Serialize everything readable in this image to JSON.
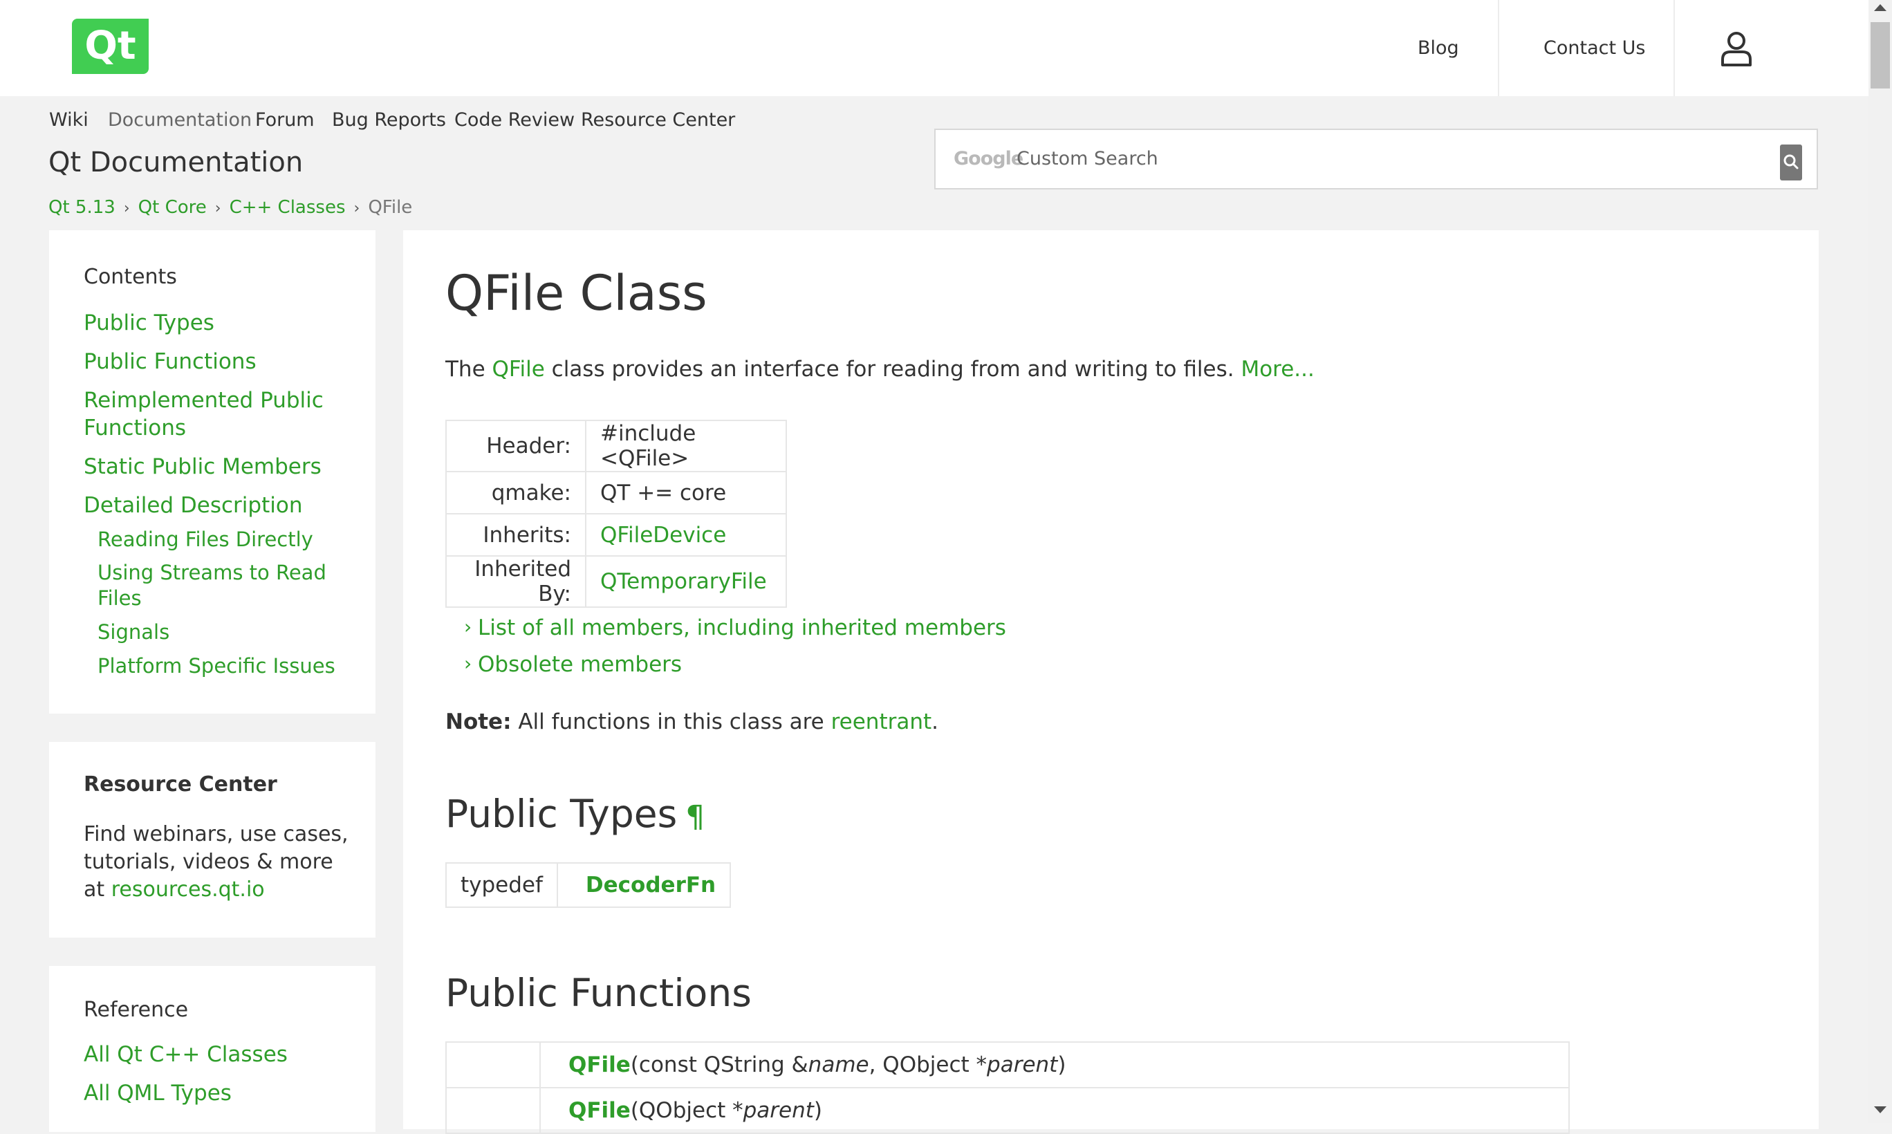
{
  "header": {
    "logo_text": "Qt",
    "nav": {
      "blog": "Blog",
      "contact": "Contact Us"
    }
  },
  "subnav": {
    "items": [
      "Wiki",
      "Documentation",
      "Forum",
      "Bug Reports",
      "Code Review",
      "Resource Center"
    ]
  },
  "site_title": "Qt Documentation",
  "breadcrumb": [
    "Qt 5.13",
    "Qt Core",
    "C++ Classes",
    "QFile"
  ],
  "search": {
    "brand": "Google",
    "placeholder": "Custom Search"
  },
  "sidebar": {
    "contents": {
      "heading": "Contents",
      "links": [
        "Public Types",
        "Public Functions",
        "Reimplemented Public Functions",
        "Static Public Members",
        "Detailed Description"
      ],
      "sublinks": [
        "Reading Files Directly",
        "Using Streams to Read Files",
        "Signals",
        "Platform Specific Issues"
      ]
    },
    "resource_center": {
      "heading": "Resource Center",
      "text": "Find webinars, use cases, tutorials, videos & more at",
      "link": "resources.qt.io"
    },
    "reference": {
      "heading": "Reference",
      "links": [
        "All Qt C++ Classes",
        "All QML Types"
      ]
    }
  },
  "main": {
    "title": "QFile Class",
    "brief": {
      "prefix": "The ",
      "class_link": "QFile",
      "text": " class provides an interface for reading from and writing to files. ",
      "more": "More..."
    },
    "info": [
      {
        "key": "Header:",
        "value": "#include <QFile>"
      },
      {
        "key": "qmake:",
        "value": "QT += core"
      },
      {
        "key": "Inherits:",
        "value": "QFileDevice"
      },
      {
        "key": "Inherited By:",
        "value": "QTemporaryFile"
      }
    ],
    "member_links": [
      "List of all members, including inherited members",
      "Obsolete members"
    ],
    "note": {
      "label": "Note:",
      "text": " All functions in this class are ",
      "link": "reentrant",
      "end": "."
    },
    "public_types": {
      "heading": "Public Types",
      "pilcrow": "¶",
      "rows": [
        {
          "type": "typedef",
          "name": "DecoderFn"
        }
      ]
    },
    "public_functions": {
      "heading": "Public Functions",
      "rows": [
        {
          "name": "QFile",
          "open": "(const QString &",
          "p1": "name",
          "mid": ", QObject *",
          "p2": "parent",
          "close": ")"
        },
        {
          "name": "QFile",
          "open": "(QObject *",
          "p1": "parent",
          "close": ")"
        }
      ]
    }
  },
  "colors": {
    "accent": "#41cd52",
    "link": "#2e9d2a",
    "background": "#f2f2f2"
  }
}
